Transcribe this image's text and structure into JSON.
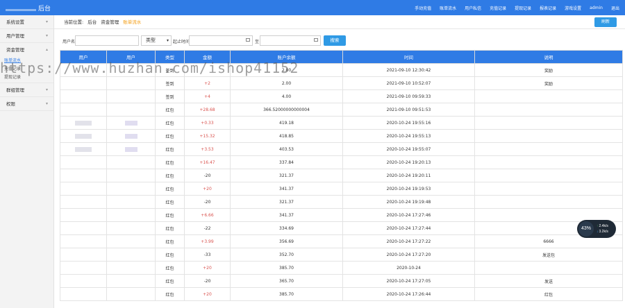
{
  "header": {
    "brand": "后台",
    "nav": [
      "手动充值",
      "账单流水",
      "用户私信",
      "充值记录",
      "提现记录",
      "报表记录",
      "游戏设置",
      "admin",
      "退出"
    ]
  },
  "sidebar": {
    "groups": [
      {
        "label": "系统设置"
      },
      {
        "label": "用户管理"
      },
      {
        "label": "资金管理"
      },
      {
        "label": "群组管理"
      },
      {
        "label": "权限"
      }
    ],
    "sub_items": [
      "账单流水",
      "充值记录",
      "提现记录"
    ]
  },
  "breadcrumb": {
    "prefix": "当前位置:",
    "root": "后台",
    "parent": "资金管理",
    "current": "账单流水"
  },
  "refresh_label": "刷新",
  "filters": {
    "user_label": "用户名:",
    "type_value": "类型",
    "start_label": "起止时间",
    "to_label": "至",
    "search_label": "搜索"
  },
  "table": {
    "headers": [
      "用户",
      "用户",
      "类型",
      "金额",
      "账户余额",
      "时间",
      "说明"
    ],
    "rows": [
      {
        "type": "签到",
        "amount": "",
        "balance": "2.00",
        "time": "2021-09-10 12:30:42",
        "note": "奖励"
      },
      {
        "type": "签到",
        "amount": "+2",
        "balance": "2.00",
        "time": "2021-09-10 10:52:07",
        "note": "奖励"
      },
      {
        "type": "签到",
        "amount": "+4",
        "balance": "4.00",
        "time": "2021-09-10 09:59:33",
        "note": ""
      },
      {
        "type": "红包",
        "amount": "+28.68",
        "balance": "366.52000000000004",
        "time": "2021-09-10 09:51:53",
        "note": ""
      },
      {
        "type": "红包",
        "amount": "+0.33",
        "balance": "419.18",
        "time": "2020-10-24 19:55:16",
        "note": ""
      },
      {
        "type": "红包",
        "amount": "+15.32",
        "balance": "418.85",
        "time": "2020-10-24 19:55:13",
        "note": ""
      },
      {
        "type": "红包",
        "amount": "+3.53",
        "balance": "403.53",
        "time": "2020-10-24 19:55:07",
        "note": ""
      },
      {
        "type": "红包",
        "amount": "+16.47",
        "balance": "337.84",
        "time": "2020-10-24 19:20:13",
        "note": ""
      },
      {
        "type": "红包",
        "amount": "-20",
        "balance": "321.37",
        "time": "2020-10-24 19:20:11",
        "note": ""
      },
      {
        "type": "红包",
        "amount": "+20",
        "balance": "341.37",
        "time": "2020-10-24 19:19:53",
        "note": ""
      },
      {
        "type": "红包",
        "amount": "-20",
        "balance": "321.37",
        "time": "2020-10-24 19:19:48",
        "note": ""
      },
      {
        "type": "红包",
        "amount": "+6.66",
        "balance": "341.37",
        "time": "2020-10-24 17:27:46",
        "note": ""
      },
      {
        "type": "红包",
        "amount": "-22",
        "balance": "334.69",
        "time": "2020-10-24 17:27:44",
        "note": ""
      },
      {
        "type": "红包",
        "amount": "+3.99",
        "balance": "356.69",
        "time": "2020-10-24 17:27:22",
        "note": "6666"
      },
      {
        "type": "红包",
        "amount": "-33",
        "balance": "352.70",
        "time": "2020-10-24 17:27:20",
        "note": "发送包"
      },
      {
        "type": "红包",
        "amount": "+20",
        "balance": "385.70",
        "time": "2020-10-24",
        "note": ""
      },
      {
        "type": "红包",
        "amount": "-20",
        "balance": "365.70",
        "time": "2020-10-24 17:27:05",
        "note": "发送"
      },
      {
        "type": "红包",
        "amount": "+20",
        "balance": "385.70",
        "time": "2020-10-24 17:26:44",
        "note": "红包"
      }
    ]
  },
  "watermark": "https://www.huzhan.com/ishop41152",
  "speed_widget": {
    "percent": "43%",
    "up": "2.4k/s",
    "down": "3.2k/s"
  }
}
